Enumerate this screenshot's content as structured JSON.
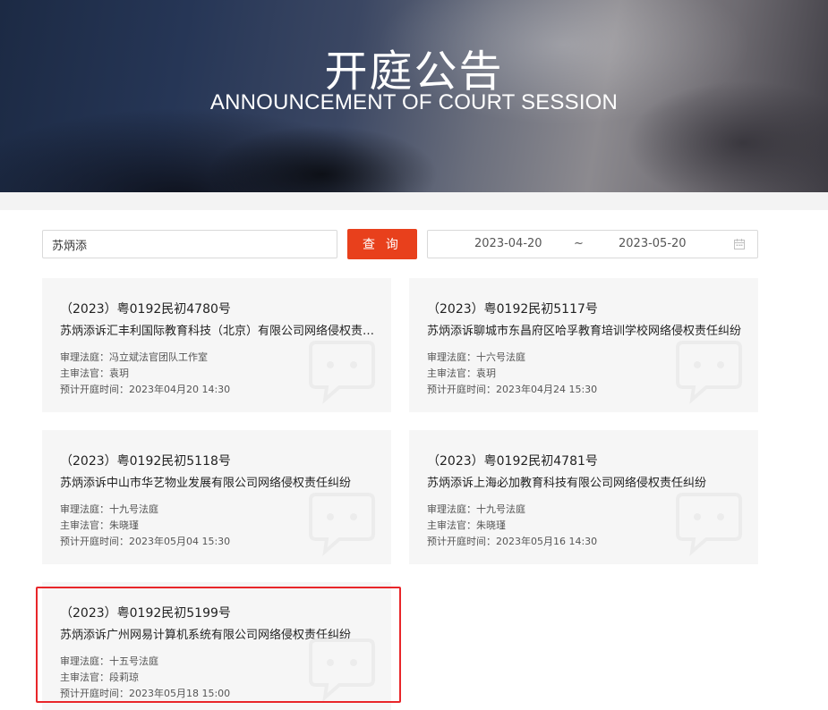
{
  "banner": {
    "title": "开庭公告",
    "subtitle": "ANNOUNCEMENT OF COURT SESSION"
  },
  "search": {
    "value": "苏炳添",
    "button_label": "查 询",
    "date_start": "2023-04-20",
    "date_separator": "~",
    "date_end": "2023-05-20"
  },
  "cards": [
    {
      "case_no": "（2023）粤0192民初4780号",
      "title": "苏炳添诉汇丰利国际教育科技（北京）有限公司网络侵权责任纠纷",
      "court": "审理法庭：冯立斌法官团队工作室",
      "judge": "主审法官：袁玥",
      "time": "预计开庭时间：2023年04月20 14:30"
    },
    {
      "case_no": "（2023）粤0192民初5117号",
      "title": "苏炳添诉聊城市东昌府区哈孚教育培训学校网络侵权责任纠纷",
      "court": "审理法庭：十六号法庭",
      "judge": "主审法官：袁玥",
      "time": "预计开庭时间：2023年04月24 15:30"
    },
    {
      "case_no": "（2023）粤0192民初5118号",
      "title": "苏炳添诉中山市华艺物业发展有限公司网络侵权责任纠纷",
      "court": "审理法庭：十九号法庭",
      "judge": "主审法官：朱晓瑾",
      "time": "预计开庭时间：2023年05月04 15:30"
    },
    {
      "case_no": "（2023）粤0192民初4781号",
      "title": "苏炳添诉上海必加教育科技有限公司网络侵权责任纠纷",
      "court": "审理法庭：十九号法庭",
      "judge": "主审法官：朱晓瑾",
      "time": "预计开庭时间：2023年05月16 14:30"
    },
    {
      "case_no": "（2023）粤0192民初5199号",
      "title": "苏炳添诉广州网易计算机系统有限公司网络侵权责任纠纷",
      "court": "审理法庭：十五号法庭",
      "judge": "主审法官：段莉琼",
      "time": "预计开庭时间：2023年05月18 15:00"
    }
  ],
  "colors": {
    "accent": "#e8401c",
    "highlight": "#e8262a",
    "card_bg": "#f6f6f6"
  }
}
